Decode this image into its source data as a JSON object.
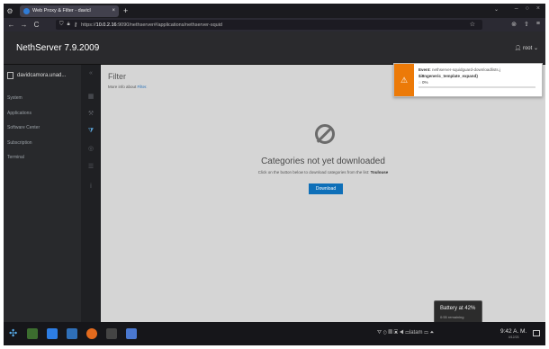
{
  "browser": {
    "tab_title": "Web Proxy & Filter - davicl",
    "tab_close": "×",
    "new_tab": "+",
    "tab_list": "⌄",
    "win_min": "–",
    "win_max": "○",
    "win_close": "×",
    "url_prefix": "https://",
    "url_host": "10.0.2.16",
    "url_path": ":9090/nethserver#/applications/nethserver-squid",
    "back": "←",
    "forward": "→",
    "reload": "C",
    "star": "☆"
  },
  "header": {
    "brand": "NethServer 7.9.2009",
    "user": "root"
  },
  "sidebar": {
    "host": "davidcamora.unad...",
    "items": [
      {
        "label": "System"
      },
      {
        "label": "Applications"
      },
      {
        "label": "Software Center"
      },
      {
        "label": "Subscription"
      },
      {
        "label": "Terminal"
      }
    ]
  },
  "main": {
    "title": "Filter",
    "subtitle_text": "More info about",
    "subtitle_link": "Filter.",
    "empty_title": "Categories not yet downloaded",
    "empty_text": "Click on the button below to download categories from the list:",
    "empty_list": "Toulouse",
    "download_label": "Download"
  },
  "notification": {
    "event_label": "Event:",
    "event_value": "nethserver-squidguard-downloadlists.j",
    "line2": "$i8ngeneric_template_expand}",
    "line3": "0%",
    "progress": 0
  },
  "battery": {
    "title": "Battery at 42%",
    "sub": "0:55 remaining"
  },
  "taskbar": {
    "time": "9:42 A. M.",
    "date": "4/12/23",
    "tray_lang": "latam"
  },
  "colors": {
    "accent": "#0e6fb8",
    "warning": "#ec7a08",
    "header_bg": "#2a2a2d",
    "main_bg": "#d5d5d5"
  }
}
